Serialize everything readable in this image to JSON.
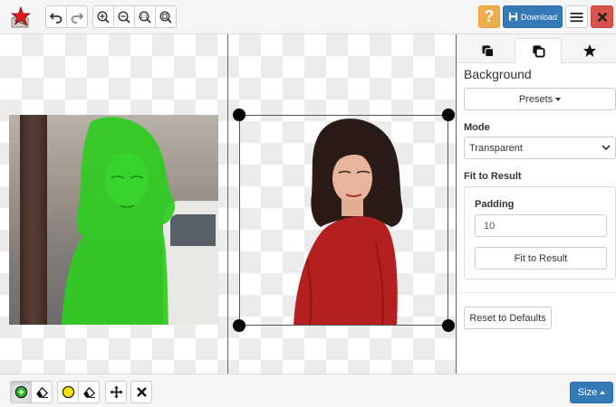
{
  "toolbar": {
    "logo_icon": "app-logo-icon",
    "history": [
      "undo-icon",
      "redo-icon"
    ],
    "zoom": [
      "zoom-in-icon",
      "zoom-out-icon",
      "zoom-actual-size-icon",
      "zoom-fit-icon"
    ],
    "help_label": "?",
    "download_label": "Download",
    "menu_icon": "hamburger-menu-icon",
    "close_icon": "close-icon"
  },
  "panel": {
    "tabs": [
      "copy-icon-filled",
      "copy-icon-outline",
      "star-icon"
    ],
    "active_tab": 1,
    "title": "Background",
    "presets_label": "Presets",
    "mode_label": "Mode",
    "mode_value": "Transparent",
    "fit_section_label": "Fit to Result",
    "padding_label": "Padding",
    "padding_value": "10",
    "fit_button_label": "Fit to Result",
    "reset_label": "Reset to Defaults"
  },
  "bottom": {
    "tools": [
      "foreground-marker-icon",
      "eraser-icon",
      "background-marker-icon",
      "eraser-icon",
      "move-icon",
      "clear-icon"
    ],
    "size_label": "Size"
  },
  "colors": {
    "primary": "#337ab7",
    "warning": "#f0ad4e",
    "danger": "#d9534f",
    "mask_green": "#2ecc1f",
    "marker_green": "#28b828",
    "marker_yellow": "#f2e10a",
    "sweater_red": "#b3201f"
  }
}
